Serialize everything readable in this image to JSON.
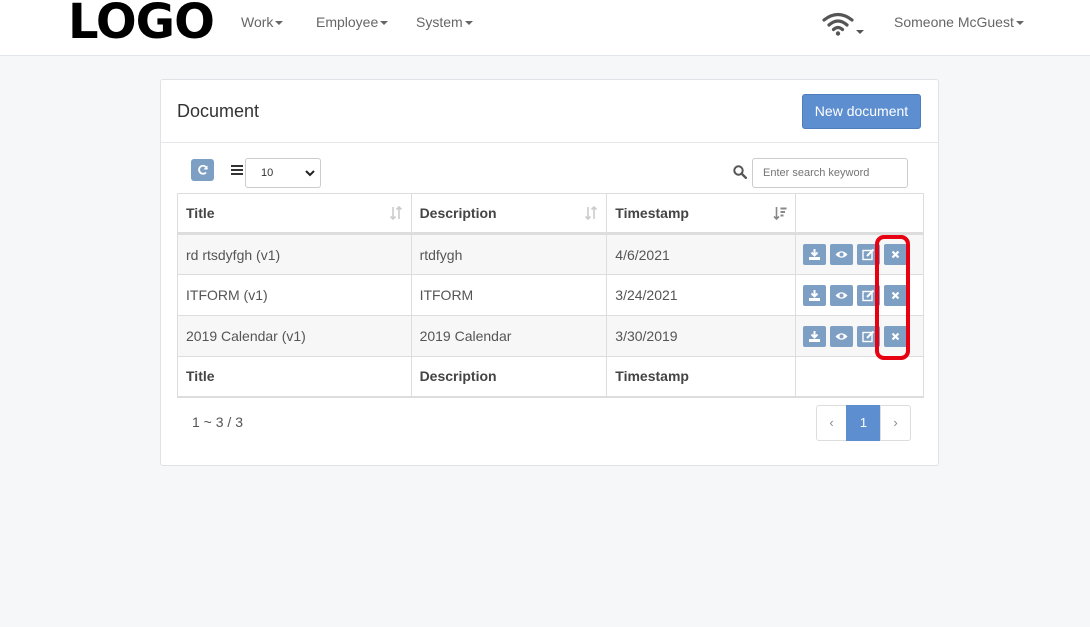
{
  "navbar": {
    "logo": "LOGO",
    "menu": [
      {
        "label": "Work"
      },
      {
        "label": "Employee"
      },
      {
        "label": "System"
      }
    ],
    "user": "Someone McGuest"
  },
  "panel": {
    "title": "Document",
    "new_button": "New document"
  },
  "toolbar": {
    "page_size": "10",
    "search_placeholder": "Enter search keyword"
  },
  "table": {
    "headers": [
      "Title",
      "Description",
      "Timestamp"
    ],
    "rows": [
      {
        "title": "rd rtsdyfgh (v1)",
        "description": "rtdfygh",
        "timestamp": "4/6/2021"
      },
      {
        "title": "ITFORM (v1)",
        "description": "ITFORM",
        "timestamp": "3/24/2021"
      },
      {
        "title": "2019 Calendar (v1)",
        "description": "2019 Calendar",
        "timestamp": "3/30/2019"
      }
    ],
    "footer": [
      "Title",
      "Description",
      "Timestamp"
    ]
  },
  "pagination": {
    "info": "1 ~ 3 / 3",
    "prev": "‹",
    "current": "1",
    "next": "›"
  },
  "colors": {
    "primary": "#5d8fd0",
    "action_button": "#7d9fc4",
    "highlight": "#e60012"
  }
}
